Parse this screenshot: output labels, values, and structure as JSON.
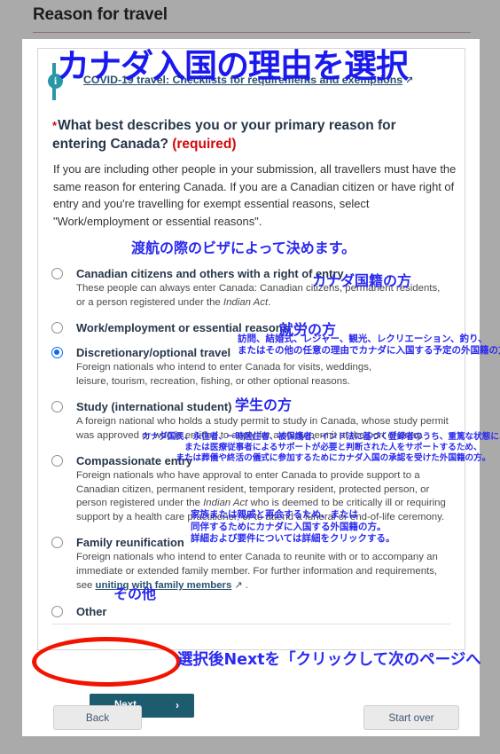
{
  "header": {
    "title": "Reason for travel"
  },
  "info_callout": {
    "icon": "info-icon",
    "link_text": "COVID-19 travel: Checklists for requirements and exemptions",
    "external_icon": "external-link-icon"
  },
  "question": {
    "required_marker": "*",
    "text": "What best describes you or your primary reason for entering Canada? ",
    "required_label": "(required)",
    "help_text": "If you are including other people in your submission, all travellers must have the same reason for entering Canada. If you are a Canadian citizen or have right of entry and you're travelling for exempt essential reasons, select \"Work/employment or essential reasons\"."
  },
  "options": [
    {
      "id": "canadian-citizens",
      "label": "Canadian citizens and others with a right of entry",
      "desc_pre": "These people can always enter Canada: Canadian citizens, permanent residents, or a person registered under the ",
      "desc_italic": "Indian Act",
      "desc_post": ".",
      "selected": false
    },
    {
      "id": "work-employment",
      "label": "Work/employment or essential reasons",
      "desc_pre": "",
      "desc_italic": "",
      "desc_post": "",
      "selected": false
    },
    {
      "id": "discretionary-optional-travel",
      "label": "Discretionary/optional travel",
      "desc_pre": "Foreign nationals who intend to enter Canada for visits, weddings, leisure, tourism, recreation, fishing, or other optional reasons.",
      "desc_italic": "",
      "desc_post": "",
      "selected": true
    },
    {
      "id": "study-international-student",
      "label": "Study (international student)",
      "desc_pre": "A foreign national who holds a study permit to study in Canada, whose study permit was approved or who is entitled to apply for a study permit at the port of entry.",
      "desc_italic": "",
      "desc_post": "",
      "selected": false
    },
    {
      "id": "compassionate-entry",
      "label": "Compassionate entry",
      "desc_pre": "Foreign nationals who have approval to enter Canada to provide support to a Canadian citizen, permanent resident, temporary resident, protected person, or person registered under the ",
      "desc_italic": "Indian Act",
      "desc_post": " who is deemed to be critically ill or requiring support by a health care practitioner, or to attend a funeral or end-of-life ceremony.",
      "selected": false
    },
    {
      "id": "family-reunification",
      "label": "Family reunification",
      "desc_pre": "Foreign nationals who intend to enter Canada to reunite with or to accompany an immediate or extended family member. For further information and requirements, see ",
      "desc_link": "uniting with family members",
      "desc_italic": "",
      "desc_post": " .",
      "selected": false
    },
    {
      "id": "other",
      "label": "Other",
      "desc_pre": "",
      "desc_italic": "",
      "desc_post": "",
      "selected": false
    }
  ],
  "buttons": {
    "next": "Next",
    "next_chevron": "chevron-right-icon",
    "back": "Back",
    "start_over": "Start over"
  },
  "annotations": {
    "title": "カナダ入国の理由を選択",
    "visa": "渡航の際のビザによって決めます。",
    "citizen": "カナダ国籍の方",
    "work": "就労の方",
    "discretionary": "訪問、結婚式、レジャー、観光、レクリエーション、釣り、\nまたはその他の任意の理由でカナダに入国する予定の外国籍の方。",
    "study": "学生の方",
    "compassionate": "カナダ国民、永住者、一時居住者、被保護者、インド法に基づく登録者のうち、重篤な状態にある、\nまたは医療従事者によるサポートが必要と判断された人をサポートするため、\nまたは葬儀や終活の儀式に参加するためにカナダ入国の承認を受けた外国籍の方。",
    "family": "家族または親戚と再会するため、または\n同伴するためにカナダに入国する外国籍の方。\n詳細および要件については詳細をクリックする。",
    "other": "その他",
    "next": "選択後Nextを「クリックして次のページへ"
  },
  "colors": {
    "page_background": "#aaaaaa",
    "annotation_blue": "#2a2af0",
    "required_red": "#d3080c",
    "next_button": "#1d5b6e",
    "highlight_red": "#f21400",
    "info_teal": "#2897a8",
    "radio_selected": "#0d6ae8",
    "heading_navy": "#26374a"
  }
}
